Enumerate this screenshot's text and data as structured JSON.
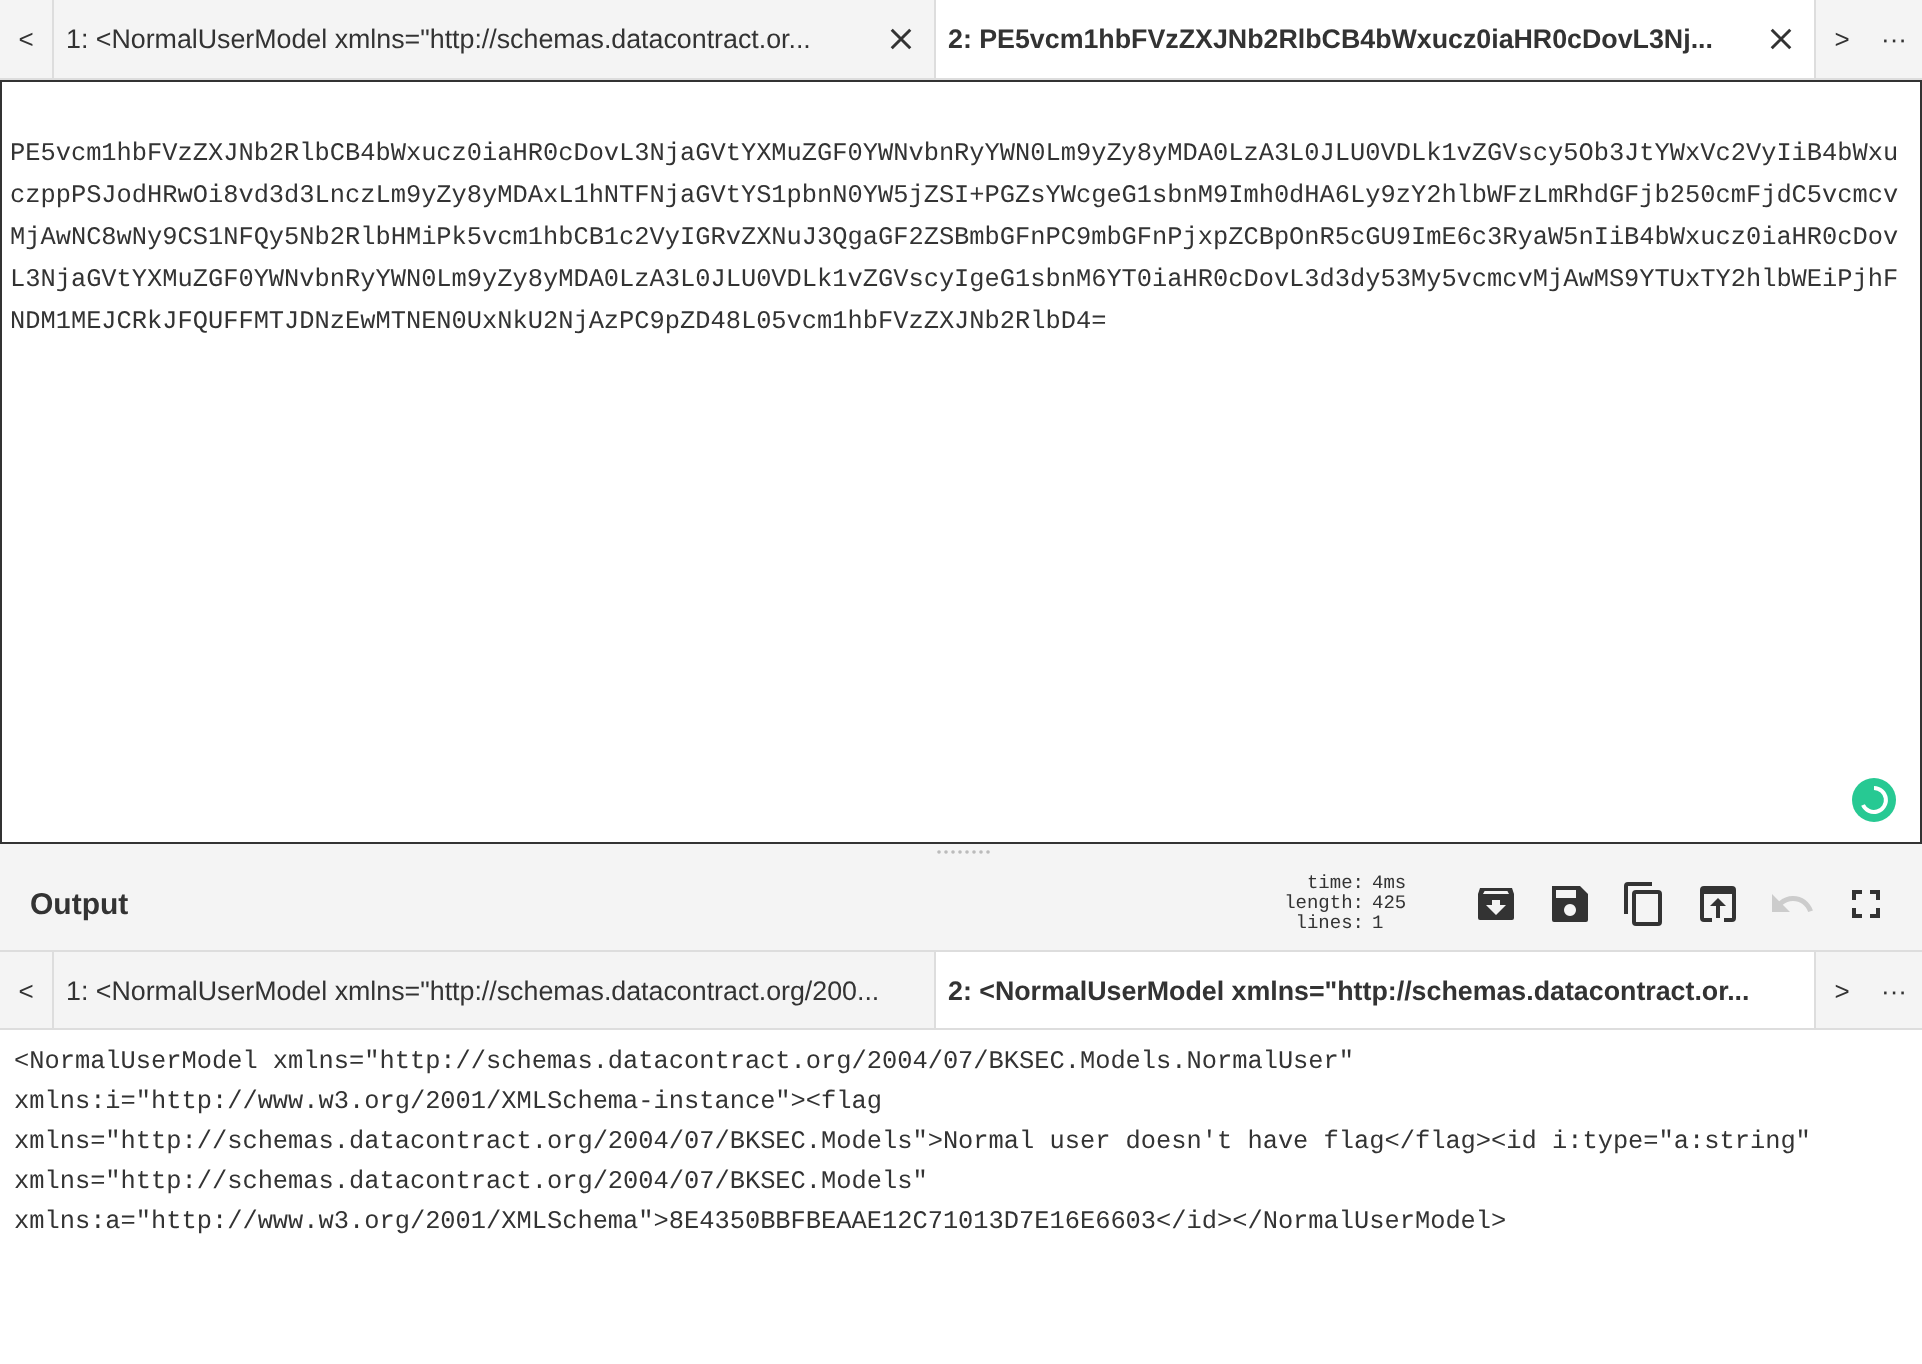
{
  "input": {
    "nav": {
      "prev": "<",
      "next": ">",
      "more": "···"
    },
    "tabs": [
      {
        "label": "1: <NormalUserModel xmlns=\"http://schemas.datacontract.or...",
        "selected": false
      },
      {
        "label": "2: PE5vcm1hbFVzZXJNb2RlbCB4bWxucz0iaHR0cDovL3Nj...",
        "selected": true
      }
    ],
    "text": "PE5vcm1hbFVzZXJNb2RlbCB4bWxucz0iaHR0cDovL3NjaGVtYXMuZGF0YWNvbnRyYWN0Lm9yZy8yMDA0LzA3L0JLU0VDLk1vZGVscy5Ob3JtYWxVc2VyIiB4bWxuczppPSJodHRwOi8vd3d3LnczLm9yZy8yMDAxL1hNTFNjaGVtYS1pbnN0YW5jZSI+PGZsYWcgeG1sbnM9Imh0dHA6Ly9zY2hlbWFzLmRhdGFjb250cmFjdC5vcmcvMjAwNC8wNy9CS1NFQy5Nb2RlbHMiPk5vcm1hbCB1c2VyIGRvZXNuJ3QgaGF2ZSBmbGFnPC9mbGFnPjxpZCBpOnR5cGU9ImE6c3RyaW5nIiB4bWxucz0iaHR0cDovL3NjaGVtYXMuZGF0YWNvbnRyYWN0Lm9yZy8yMDA0LzA3L0JLU0VDLk1vZGVscyIgeG1sbnM6YT0iaHR0cDovL3d3dy53My5vcmcvMjAwMS9YTUxTY2hlbWEiPjhFNDM1MEJCRkJFQUFFMTJDNzEwMTNEN0UxNkU2NjAzPC9pZD48L05vcm1hbFVzZXJNb2RlbD4="
  },
  "output": {
    "title": "Output",
    "stats": [
      {
        "label": "time:",
        "value": "4ms"
      },
      {
        "label": "length:",
        "value": "425"
      },
      {
        "label": "lines:",
        "value": "1"
      }
    ],
    "buttons": [
      {
        "kind": "archive",
        "disabled": false
      },
      {
        "kind": "save",
        "disabled": false
      },
      {
        "kind": "copy",
        "disabled": false
      },
      {
        "kind": "replace",
        "disabled": false
      },
      {
        "kind": "undo",
        "disabled": true
      },
      {
        "kind": "maximise",
        "disabled": false
      }
    ],
    "nav": {
      "prev": "<",
      "next": ">",
      "more": "···"
    },
    "tabs": [
      {
        "label": "1: <NormalUserModel xmlns=\"http://schemas.datacontract.org/200...",
        "selected": false
      },
      {
        "label": "2: <NormalUserModel xmlns=\"http://schemas.datacontract.or...",
        "selected": true
      }
    ],
    "text": "<NormalUserModel xmlns=\"http://schemas.datacontract.org/2004/07/BKSEC.Models.NormalUser\" xmlns:i=\"http://www.w3.org/2001/XMLSchema-instance\"><flag xmlns=\"http://schemas.datacontract.org/2004/07/BKSEC.Models\">Normal user doesn't have flag</flag><id i:type=\"a:string\" xmlns=\"http://schemas.datacontract.org/2004/07/BKSEC.Models\" xmlns:a=\"http://www.w3.org/2001/XMLSchema\">8E4350BBFBEAAE12C71013D7E16E6603</id></NormalUserModel>"
  }
}
